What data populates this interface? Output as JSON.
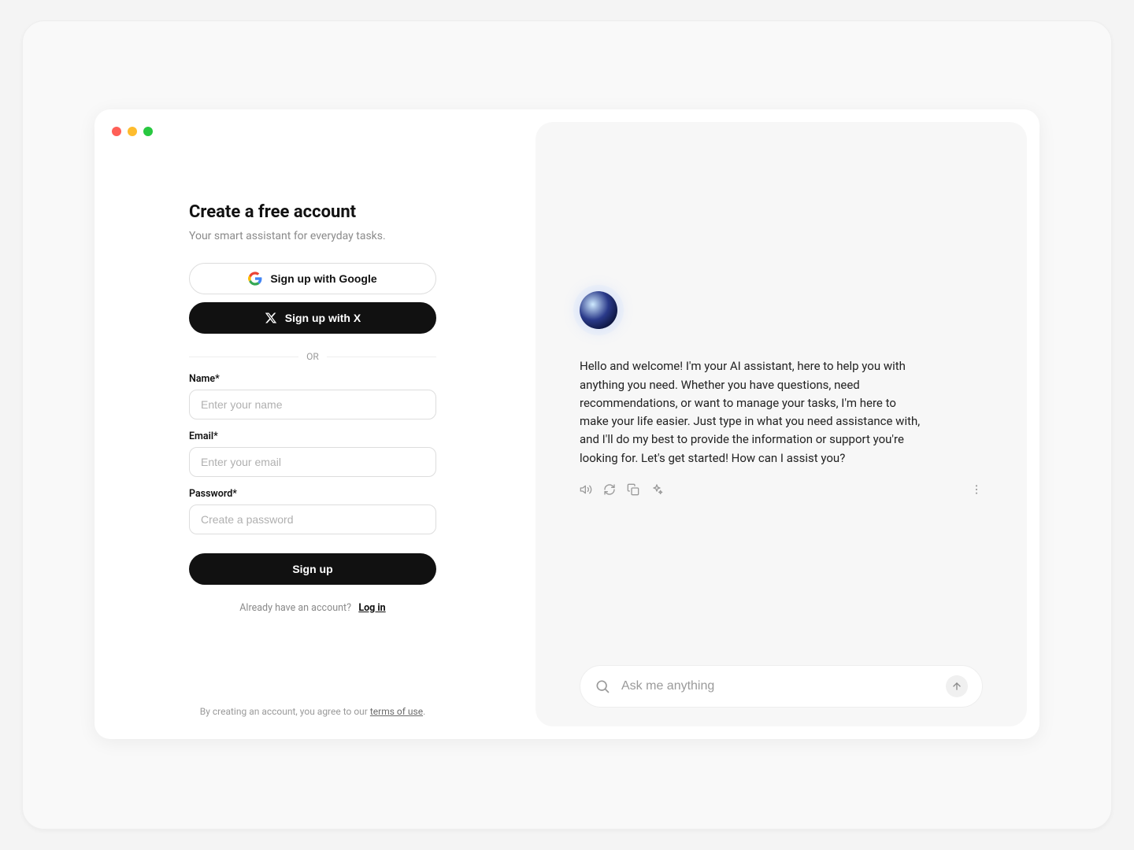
{
  "signup": {
    "title": "Create a free account",
    "subtitle": "Your smart assistant for everyday tasks.",
    "google_label": "Sign up with Google",
    "x_label": "Sign up with X",
    "divider": "OR",
    "name_label": "Name*",
    "name_placeholder": "Enter your name",
    "email_label": "Email*",
    "email_placeholder": "Enter your email",
    "password_label": "Password*",
    "password_placeholder": "Create a password",
    "submit_label": "Sign up",
    "login_prompt": "Already have an account?",
    "login_link": "Log in",
    "legal_prefix": "By creating an account, you agree to our ",
    "legal_link": "terms of use",
    "legal_suffix": "."
  },
  "chat": {
    "welcome_message": "Hello and welcome! I'm your AI assistant, here to help you with anything you need. Whether you have questions, need recommendations, or want to manage your tasks, I'm here to make your life easier. Just type in what you need assistance with, and I'll do my best to provide the information or support you're looking for. Let's get started! How can I assist you?",
    "input_placeholder": "Ask me anything"
  }
}
